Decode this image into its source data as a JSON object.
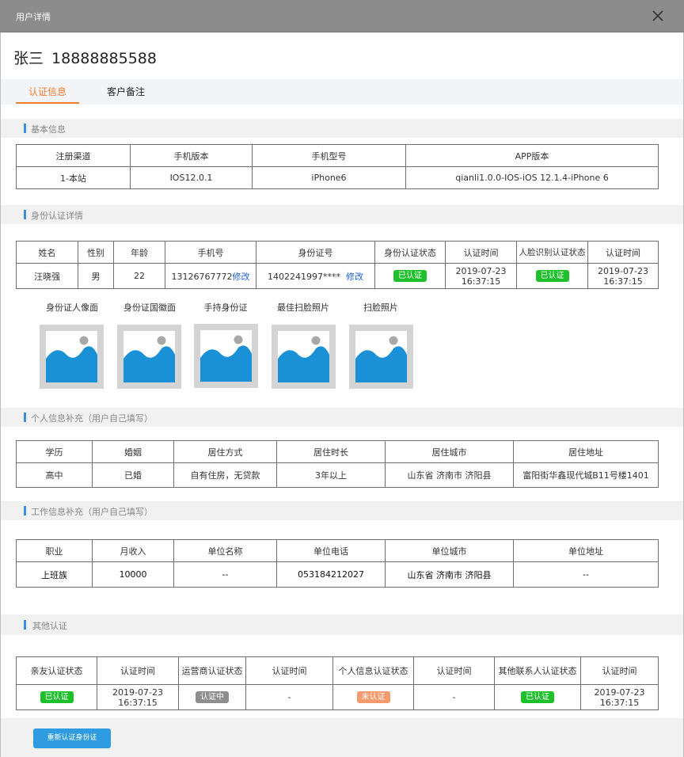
{
  "dialog": {
    "title": "用户详情"
  },
  "user": {
    "name": "张三",
    "phone": "18888885588"
  },
  "tabs": [
    {
      "label": "认证信息",
      "active": true
    },
    {
      "label": "客户备注",
      "active": false
    }
  ],
  "sections": {
    "basic": "基本信息",
    "identity": "身份认证详情",
    "personal": "个人信息补充（用户自己填写）",
    "work": "工作信息补充（用户自己填写）",
    "other": "其他认证"
  },
  "basic_table": {
    "headers": [
      "注册渠道",
      "手机版本",
      "手机型号",
      "APP版本"
    ],
    "row": [
      "1-本站",
      "IOS12.0.1",
      "iPhone6",
      "qianli1.0.0-IOS-iOS 12.1.4-iPhone 6"
    ]
  },
  "identity_table": {
    "headers": [
      "姓名",
      "性别",
      "年龄",
      "手机号",
      "身份证号",
      "身份认证状态",
      "认证时间",
      "人脸识别认证状态",
      "认证时间"
    ],
    "name": "汪晓强",
    "gender": "男",
    "age": "22",
    "phone": "13126767772",
    "id_number": "1402241997****",
    "edit_label": "修改",
    "id_status": "已认证",
    "id_time": "2019-07-23 16:37:15",
    "face_status": "已认证",
    "face_time": "2019-07-23 16:37:15"
  },
  "photos": [
    {
      "label": "身份证人像面"
    },
    {
      "label": "身份证国徽面"
    },
    {
      "label": "手持身份证"
    },
    {
      "label": "最佳扫脸照片"
    },
    {
      "label": "扫脸照片"
    }
  ],
  "personal_table": {
    "headers": [
      "学历",
      "婚姻",
      "居住方式",
      "居住时长",
      "居住城市",
      "居住地址"
    ],
    "row": [
      "高中",
      "已婚",
      "自有住房，无贷款",
      "3年以上",
      "山东省 济南市 济阳县",
      "富阳街华鑫现代城B11号楼1401"
    ]
  },
  "work_table": {
    "headers": [
      "职业",
      "月收入",
      "单位名称",
      "单位电话",
      "单位城市",
      "单位地址"
    ],
    "row": [
      "上班族",
      "10000",
      "--",
      "053184212027",
      "山东省 济南市 济阳县",
      "--"
    ]
  },
  "other_table": {
    "headers": [
      "亲友认证状态",
      "认证时间",
      "运营商认证状态",
      "认证时间",
      "个人信息认证状态",
      "认证时间",
      "其他联系人认证状态",
      "认证时间"
    ],
    "friend_status": "已认证",
    "friend_time": "2019-07-23 16:37:15",
    "carrier_status": "认证中",
    "carrier_time": "-",
    "personal_status": "未认证",
    "personal_time": "-",
    "contact_status": "已认证",
    "contact_time": "2019-07-23 16:37:15"
  },
  "actions": {
    "reauth_label": "重新认证身份证"
  },
  "colors": {
    "accent": "#f07d2b",
    "primary": "#2f9be0",
    "green": "#1ec02b",
    "gray": "#8e8e8e",
    "orange": "#f59a6c"
  }
}
